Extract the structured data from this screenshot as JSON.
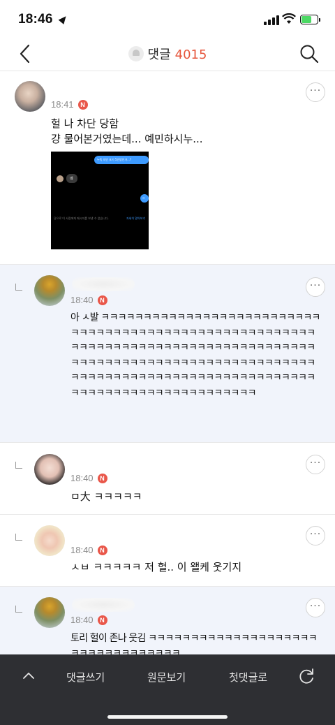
{
  "status_bar": {
    "time": "18:46"
  },
  "header": {
    "title": "댓글",
    "count": "4015"
  },
  "comments": [
    {
      "time": "18:41",
      "badge": "N",
      "text": "헐 나 차단 당함\n걍 물어본거였는데... 예민하시누...",
      "attachment": {
        "bubble1": "누독 지인 포기 5인방인가...?",
        "reply_text": "네",
        "bubble2": "ㅁ",
        "notice": "당으로 이 사람에게 메시지를 보낼 수 없습니다.",
        "link": "자세히 알아보기"
      }
    },
    {
      "time": "18:40",
      "badge": "N",
      "text": "아 ㅅ발 ㅋㅋㅋㅋㅋㅋㅋㅋㅋㅋㅋㅋㅋㅋㅋㅋㅋㅋㅋㅋㅋㅋㅋㅋㅋㅋㅋㅋㅋㅋㅋㅋㅋㅋㅋㅋㅋㅋㅋㅋㅋㅋㅋㅋㅋㅋㅋㅋㅋㅋㅋㅋㅋㅋㅋㅋㅋㅋㅋㅋㅋㅋㅋㅋㅋㅋㅋㅋㅋㅋㅋㅋㅋㅋㅋㅋㅋㅋㅋㅋㅋㅋㅋㅋㅋㅋㅋㅋㅋㅋㅋㅋㅋㅋㅋㅋㅋㅋㅋㅋㅋㅋㅋㅋㅋㅋㅋㅋㅋㅋㅋㅋㅋㅋㅋㅋㅋㅋㅋㅋㅋㅋㅋㅋㅋㅋㅋㅋㅋㅋㅋㅋㅋㅋㅋㅋㅋㅋㅋㅋㅋㅋㅋㅋㅋㅋㅋㅋㅋㅋㅋㅋㅋㅋㅋㅋㅋㅋㅋㅋㅋㅋㅋㅋ"
    },
    {
      "time": "18:40",
      "badge": "N",
      "text": "ㅁ大 ㅋㅋㅋㅋㅋ"
    },
    {
      "time": "18:40",
      "badge": "N",
      "text": "ㅅㅂ ㅋㅋㅋㅋㅋ 저 헐.. 이 왤케 웃기지"
    },
    {
      "time": "18:40",
      "badge": "N",
      "text": "토리 헐이 존나 웃김 ㅋㅋㅋㅋㅋㅋㅋㅋㅋㅋㅋㅋㅋㅋㅋㅋㅋㅋㅋㅋㅋㅋㅋㅋㅋㅋㅋㅋㅋㅋㅋㅋㅋ"
    }
  ],
  "bottom_bar": {
    "write": "댓글쓰기",
    "original": "원문보기",
    "first": "첫댓글로"
  },
  "colors": {
    "accent": "#e6563c",
    "badge": "#e9574a",
    "reply_bg": "#f1f4fb",
    "bottom_bar": "#2e2f33"
  }
}
